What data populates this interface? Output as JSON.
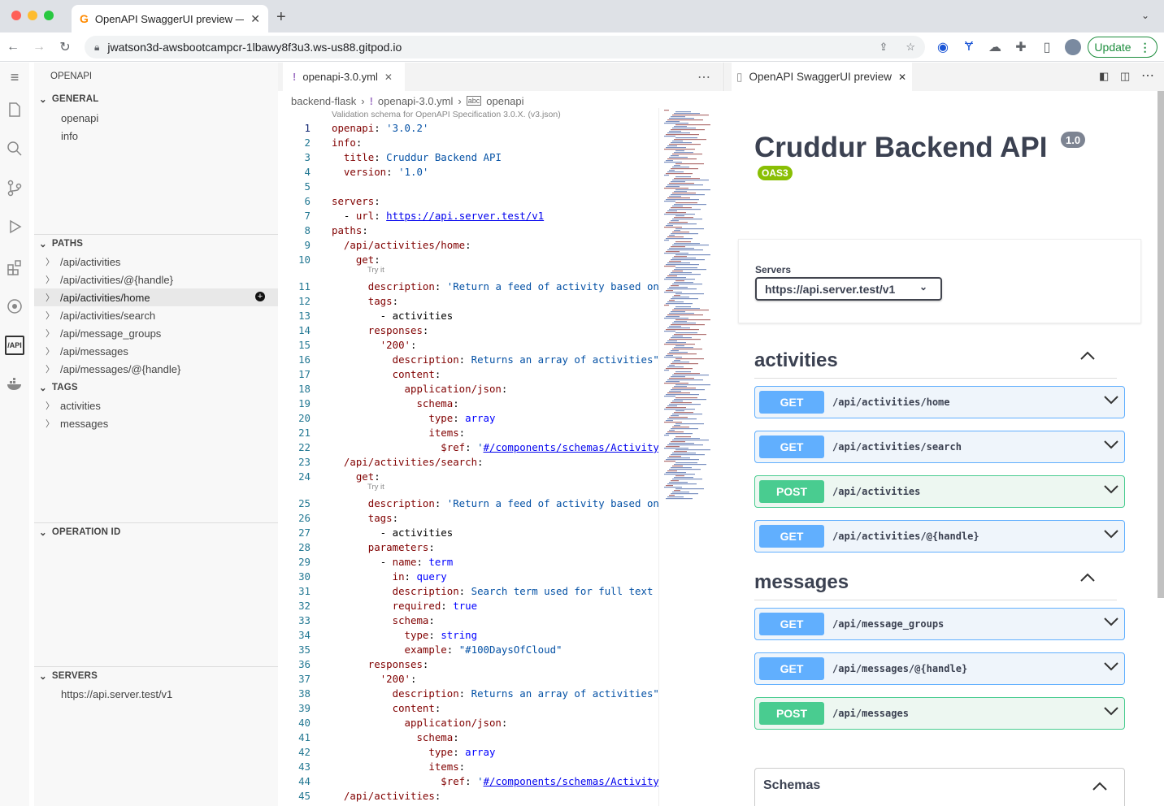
{
  "browser": {
    "tab_title": "OpenAPI SwaggerUI preview —",
    "url": "jwatson3d-awsbootcampcr-1lbawy8f3u3.ws-us88.gitpod.io",
    "update_label": "Update"
  },
  "explorer": {
    "header": "OPENAPI",
    "general": {
      "title": "GENERAL",
      "items": [
        "openapi",
        "info"
      ]
    },
    "paths": {
      "title": "PATHS",
      "items": [
        "/api/activities",
        "/api/activities/@{handle}",
        "/api/activities/home",
        "/api/activities/search",
        "/api/message_groups",
        "/api/messages",
        "/api/messages/@{handle}"
      ]
    },
    "tags": {
      "title": "TAGS",
      "items": [
        "activities",
        "messages"
      ]
    },
    "operation_id": {
      "title": "OPERATION ID"
    },
    "servers": {
      "title": "SERVERS",
      "items": [
        "https://api.server.test/v1"
      ]
    }
  },
  "editor": {
    "tab": "openapi-3.0.yml",
    "breadcrumb": [
      "backend-flask",
      "openapi-3.0.yml",
      "openapi"
    ],
    "codelens": "Validation schema for OpenAPI Specification 3.0.X. (v3.json)",
    "try_it": "Try it",
    "lines": [
      {
        "n": "1",
        "t": "openapi: '3.0.2'"
      },
      {
        "n": "2",
        "t": "info:"
      },
      {
        "n": "3",
        "t": "  title: Cruddur Backend API"
      },
      {
        "n": "4",
        "t": "  version: '1.0'"
      },
      {
        "n": "5",
        "t": ""
      },
      {
        "n": "6",
        "t": "servers:"
      },
      {
        "n": "7",
        "t": "  - url: https://api.server.test/v1"
      },
      {
        "n": "8",
        "t": "paths:"
      },
      {
        "n": "9",
        "t": "  /api/activities/home:"
      },
      {
        "n": "10",
        "t": "    get:"
      },
      {
        "n": "11",
        "t": "      description: 'Return a feed of activity based on a"
      },
      {
        "n": "12",
        "t": "      tags:"
      },
      {
        "n": "13",
        "t": "        - activities"
      },
      {
        "n": "14",
        "t": "      responses:"
      },
      {
        "n": "15",
        "t": "        '200':"
      },
      {
        "n": "16",
        "t": "          description: Returns an array of activities\""
      },
      {
        "n": "17",
        "t": "          content:"
      },
      {
        "n": "18",
        "t": "            application/json:"
      },
      {
        "n": "19",
        "t": "              schema:"
      },
      {
        "n": "20",
        "t": "                type: array"
      },
      {
        "n": "21",
        "t": "                items:"
      },
      {
        "n": "22",
        "t": "                  $ref: '#/components/schemas/Activity'"
      },
      {
        "n": "23",
        "t": "  /api/activities/search:"
      },
      {
        "n": "24",
        "t": "    get:"
      },
      {
        "n": "25",
        "t": "      description: 'Return a feed of activity based on a"
      },
      {
        "n": "26",
        "t": "      tags:"
      },
      {
        "n": "27",
        "t": "        - activities"
      },
      {
        "n": "28",
        "t": "      parameters:"
      },
      {
        "n": "29",
        "t": "        - name: term"
      },
      {
        "n": "30",
        "t": "          in: query"
      },
      {
        "n": "31",
        "t": "          description: Search term used for full text se"
      },
      {
        "n": "32",
        "t": "          required: true"
      },
      {
        "n": "33",
        "t": "          schema:"
      },
      {
        "n": "34",
        "t": "            type: string"
      },
      {
        "n": "35",
        "t": "            example: \"#100DaysOfCloud\""
      },
      {
        "n": "36",
        "t": "      responses:"
      },
      {
        "n": "37",
        "t": "        '200':"
      },
      {
        "n": "38",
        "t": "          description: Returns an array of activities\""
      },
      {
        "n": "39",
        "t": "          content:"
      },
      {
        "n": "40",
        "t": "            application/json:"
      },
      {
        "n": "41",
        "t": "              schema:"
      },
      {
        "n": "42",
        "t": "                type: array"
      },
      {
        "n": "43",
        "t": "                items:"
      },
      {
        "n": "44",
        "t": "                  $ref: '#/components/schemas/Activity'"
      },
      {
        "n": "45",
        "t": "  /api/activities:"
      }
    ]
  },
  "swagger": {
    "tab": "OpenAPI SwaggerUI preview",
    "title": "Cruddur Backend API",
    "version": "1.0",
    "oas": "OAS3",
    "servers_label": "Servers",
    "server_selected": "https://api.server.test/v1",
    "tags": [
      {
        "name": "activities",
        "ops": [
          {
            "method": "GET",
            "path": "/api/activities/home"
          },
          {
            "method": "GET",
            "path": "/api/activities/search"
          },
          {
            "method": "POST",
            "path": "/api/activities"
          },
          {
            "method": "GET",
            "path": "/api/activities/@{handle}"
          }
        ]
      },
      {
        "name": "messages",
        "ops": [
          {
            "method": "GET",
            "path": "/api/message_groups"
          },
          {
            "method": "GET",
            "path": "/api/messages/@{handle}"
          },
          {
            "method": "POST",
            "path": "/api/messages"
          }
        ]
      }
    ],
    "schemas_label": "Schemas"
  },
  "colors": {
    "get": "#61affe",
    "post": "#49cc90",
    "accent": "#1e8e3e"
  }
}
